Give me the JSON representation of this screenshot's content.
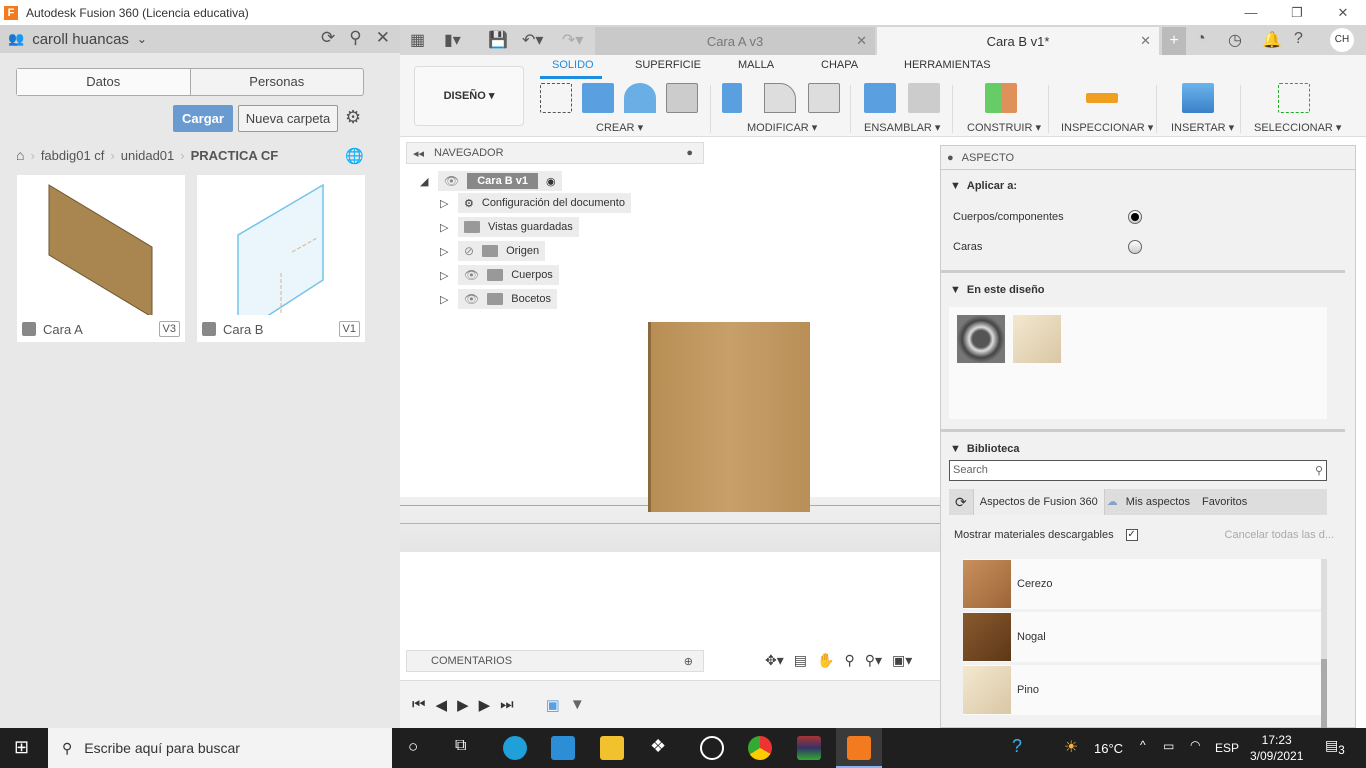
{
  "window": {
    "title": "Autodesk Fusion 360 (Licencia educativa)",
    "logo": "F",
    "minimize": "—",
    "maximize": "❐",
    "close": "✕"
  },
  "data_panel": {
    "user": "caroll huancas",
    "tabs": [
      "Datos",
      "Personas"
    ],
    "upload": "Cargar",
    "new_folder": "Nueva carpeta",
    "breadcrumb": [
      "fabdig01 cf",
      "unidad01",
      "PRACTICA CF"
    ],
    "files": [
      {
        "name": "Cara A",
        "version": "V3"
      },
      {
        "name": "Cara B",
        "version": "V1"
      }
    ]
  },
  "tabs": [
    {
      "label": "Cara A v3",
      "active": false
    },
    {
      "label": "Cara B v1*",
      "active": true
    }
  ],
  "account_initials": "CH",
  "toolbar": {
    "workspace": "DISEÑO",
    "ribbon_tabs": [
      "SOLIDO",
      "SUPERFICIE",
      "MALLA",
      "CHAPA",
      "HERRAMIENTAS"
    ],
    "active_tab": "SOLIDO",
    "groups": [
      "CREAR",
      "MODIFICAR",
      "ENSAMBLAR",
      "CONSTRUIR",
      "INSPECCIONAR",
      "INSERTAR",
      "SELECCIONAR"
    ]
  },
  "browser": {
    "title": "NAVEGADOR",
    "root": "Cara B v1",
    "items": [
      "Configuración del documento",
      "Vistas guardadas",
      "Origen",
      "Cuerpos",
      "Bocetos"
    ]
  },
  "comments": "COMENTARIOS",
  "aspect": {
    "title": "ASPECTO",
    "apply_to": "Aplicar a:",
    "options": [
      {
        "label": "Cuerpos/componentes",
        "selected": true
      },
      {
        "label": "Caras",
        "selected": false
      }
    ],
    "in_design": "En este diseño",
    "library": "Biblioteca",
    "search_placeholder": "Search",
    "lib_tabs": [
      "Aspectos de Fusion 360",
      "Mis aspectos",
      "Favoritos"
    ],
    "show_downloadable": "Mostrar materiales descargables",
    "show_downloadable_checked": true,
    "cancel_all": "Cancelar todas las d...",
    "materials": [
      "Cerezo",
      "Nogal",
      "Pino"
    ]
  },
  "taskbar": {
    "search": "Escribe aquí para buscar",
    "temp": "16°C",
    "lang": "ESP",
    "time": "17:23",
    "date": "3/09/2021",
    "notifications": "3"
  }
}
